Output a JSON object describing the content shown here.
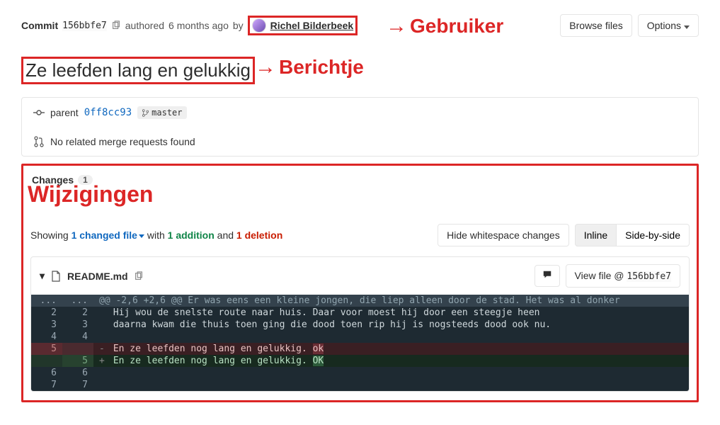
{
  "header": {
    "commit_label": "Commit",
    "sha": "156bbfe7",
    "authored_prefix": "authored",
    "authored_time": "6 months ago",
    "authored_by": "by",
    "author_name": "Richel Bilderbeek",
    "browse_files": "Browse files",
    "options": "Options"
  },
  "commit_message": "Ze leefden lang en gelukkig",
  "parent": {
    "label": "parent",
    "sha": "0ff8cc93",
    "branch": "master"
  },
  "mr_text": "No related merge requests found",
  "changes": {
    "tab_label": "Changes",
    "count": "1",
    "showing_prefix": "Showing ",
    "files_link": "1 changed file",
    "with_text": " with ",
    "additions": "1 addition",
    "and_text": " and ",
    "deletions": "1 deletion",
    "hide_ws": "Hide whitespace changes",
    "inline": "Inline",
    "sbs": "Side-by-side"
  },
  "file": {
    "name": "README.md",
    "view_file": "View file @ ",
    "view_sha": "156bbfe7"
  },
  "diff": {
    "hunk": "@@ -2,6 +2,6 @@ Er was eens een kleine jongen, die liep alleen door de stad. Het was al donker",
    "rows": [
      {
        "old": "2",
        "new": "2",
        "sign": " ",
        "text": "Hij wou de snelste route naar huis. Daar voor moest hij door een steegje heen",
        "type": "ctx"
      },
      {
        "old": "3",
        "new": "3",
        "sign": " ",
        "text": "daarna kwam die thuis toen ging die dood toen rip hij is nogsteeds dood ook nu.",
        "type": "ctx"
      },
      {
        "old": "4",
        "new": "4",
        "sign": " ",
        "text": "",
        "type": "ctx"
      },
      {
        "old": "5",
        "new": "",
        "sign": "-",
        "prefix": "En ze leefden nog lang en gelukkig. ",
        "hl": "ok",
        "type": "rem"
      },
      {
        "old": "",
        "new": "5",
        "sign": "+",
        "prefix": "En ze leefden nog lang en gelukkig. ",
        "hl": "OK",
        "type": "add"
      },
      {
        "old": "6",
        "new": "6",
        "sign": " ",
        "text": "",
        "type": "ctx"
      },
      {
        "old": "7",
        "new": "7",
        "sign": " ",
        "text": "",
        "type": "ctx"
      }
    ]
  },
  "annotations": {
    "gebruiker": "Gebruiker",
    "berichtje": "Berichtje",
    "wijzigingen": "Wijzigingen"
  }
}
